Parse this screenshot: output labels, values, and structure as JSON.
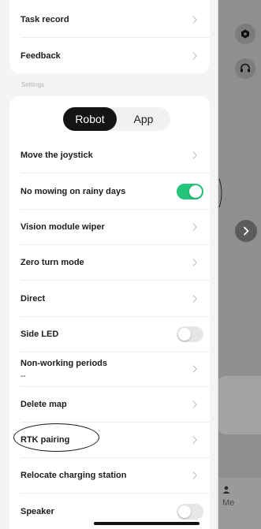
{
  "background": {
    "bottom_nav_label": "Me"
  },
  "menu_top": {
    "items": [
      {
        "label": "Task record"
      },
      {
        "label": "Feedback"
      }
    ]
  },
  "settings": {
    "section_label": "Settings",
    "segments": {
      "selected": "Robot",
      "robot_label": "Robot",
      "app_label": "App"
    },
    "items": [
      {
        "label": "Move the joystick",
        "control": "chevron"
      },
      {
        "label": "No mowing on rainy days",
        "control": "toggle",
        "toggle_on": true
      },
      {
        "label": "Vision module wiper",
        "control": "chevron"
      },
      {
        "label": "Zero turn mode",
        "control": "chevron"
      },
      {
        "label": "Direct",
        "control": "chevron"
      },
      {
        "label": "Side LED",
        "control": "toggle",
        "toggle_on": false
      },
      {
        "label": "Non-working periods",
        "value": "--",
        "control": "chevron"
      },
      {
        "label": "Delete map",
        "control": "chevron"
      },
      {
        "label": "RTK pairing",
        "control": "chevron"
      },
      {
        "label": "Relocate charging station",
        "control": "chevron"
      },
      {
        "label": "Speaker",
        "control": "toggle",
        "toggle_on": false
      }
    ]
  },
  "colors": {
    "toggle_on": "#22c57a",
    "segment_selected_bg": "#141414",
    "drawer_bg": "#f4f4f6",
    "overlay_bg": "#8f8f8f"
  }
}
